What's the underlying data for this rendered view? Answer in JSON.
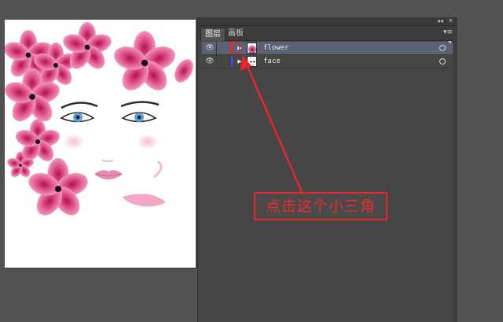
{
  "panel": {
    "collapse_icon": "double-chevron-left-icon",
    "close_icon": "close-icon",
    "tabs": [
      {
        "label": "图层",
        "active": true
      },
      {
        "label": "画板",
        "active": false
      }
    ],
    "menu_icon": "panel-menu-icon"
  },
  "layers": [
    {
      "name": "flower",
      "selected": true,
      "color": "#e8262b",
      "visible": true
    },
    {
      "name": "face",
      "selected": false,
      "color": "#3c4cff",
      "visible": true
    }
  ],
  "annotation": {
    "text": "点击这个小三角",
    "color": "#e8262b"
  }
}
